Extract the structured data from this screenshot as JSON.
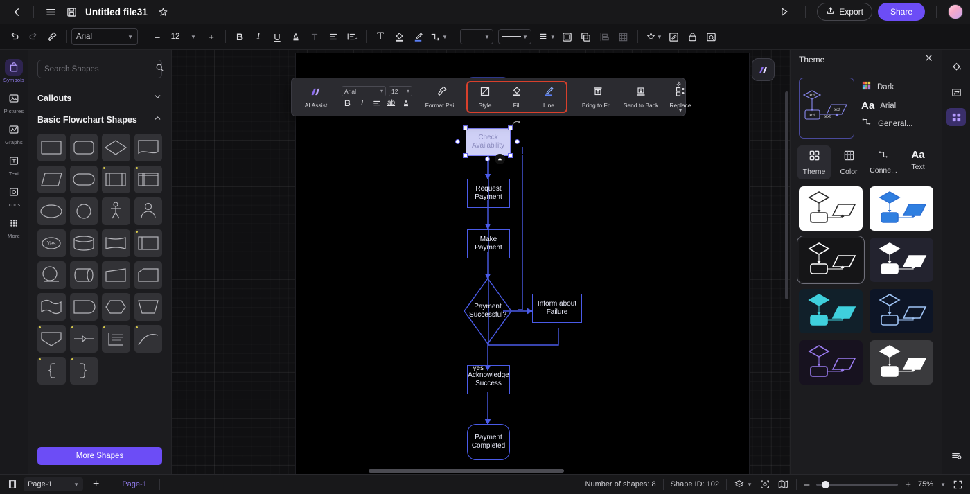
{
  "header": {
    "back_icon": "chevron-left-icon",
    "menu_icon": "hamburger-menu-icon",
    "save_icon": "floppy-save-icon",
    "title": "Untitled file31",
    "favorite_icon": "star-icon",
    "present_icon": "play-present-icon",
    "export_label": "Export",
    "export_icon": "upload-icon",
    "share_label": "Share",
    "avatar": "user-avatar"
  },
  "toolbar": {
    "undo_icon": "undo-icon",
    "redo_icon": "redo-icon",
    "format_painter_icon": "format-painter-icon",
    "font_family": "Arial",
    "font_size": "12",
    "decrease_label": "–",
    "increase_label": "+",
    "bold_label": "B",
    "italic_label": "I",
    "underline_label": "U",
    "font_color_label": "A",
    "strikethrough_label": "T",
    "align_icon": "align-left-icon",
    "line_spacing_icon": "line-spacing-icon",
    "text_box_label": "T",
    "fill_icon": "fill-bucket-icon",
    "line_brush_icon": "line-brush-icon",
    "connector_icon": "connector-icon",
    "line_style_icon": "line-style-icon",
    "line_weight_icon": "line-weight-icon",
    "list_icon": "list-icon",
    "frame_icon": "frame-icon",
    "duplicate_icon": "duplicate-icon",
    "distribute_icon": "distribute-icon",
    "table_icon": "table-icon",
    "magic_icon": "magic-wand-icon",
    "edit_icon": "edit-icon",
    "lock_icon": "lock-icon",
    "find_icon": "find-icon"
  },
  "rail": {
    "items": [
      {
        "label": "Symbols",
        "icon": "symbols-icon",
        "active": true
      },
      {
        "label": "Pictures",
        "icon": "pictures-icon",
        "active": false
      },
      {
        "label": "Graphs",
        "icon": "graphs-icon",
        "active": false
      },
      {
        "label": "Text",
        "icon": "text-icon",
        "active": false
      },
      {
        "label": "Icons",
        "icon": "icons-icon",
        "active": false
      },
      {
        "label": "More",
        "icon": "more-grid-icon",
        "active": false
      }
    ]
  },
  "shapes_panel": {
    "search_placeholder": "Search Shapes",
    "search_value": "",
    "search_icon": "search-icon",
    "sections": [
      {
        "title": "Callouts",
        "expanded": false,
        "chevron": "chevron-down-icon"
      },
      {
        "title": "Basic Flowchart Shapes",
        "expanded": true,
        "chevron": "chevron-up-icon"
      }
    ],
    "more_shapes_label": "More Shapes",
    "shape_cells": [
      {
        "shape": "rectangle",
        "badge": false
      },
      {
        "shape": "rounded-rectangle",
        "badge": false
      },
      {
        "shape": "diamond",
        "badge": false
      },
      {
        "shape": "document",
        "badge": false
      },
      {
        "shape": "parallelogram",
        "badge": false
      },
      {
        "shape": "stadium",
        "badge": false
      },
      {
        "shape": "predefined-process",
        "badge": true
      },
      {
        "shape": "internal-storage",
        "badge": true
      },
      {
        "shape": "ellipse",
        "badge": false
      },
      {
        "shape": "circle",
        "badge": false
      },
      {
        "shape": "manual-operation-person",
        "badge": false
      },
      {
        "shape": "actor",
        "badge": false
      },
      {
        "shape": "decision-yes",
        "badge": false
      },
      {
        "shape": "cylinder",
        "badge": false
      },
      {
        "shape": "tape",
        "badge": false
      },
      {
        "shape": "card",
        "badge": true
      },
      {
        "shape": "circle-connector",
        "badge": false
      },
      {
        "shape": "direct-access-storage",
        "badge": false
      },
      {
        "shape": "manual-input",
        "badge": false
      },
      {
        "shape": "trapezoid-top",
        "badge": false
      },
      {
        "shape": "wave-document",
        "badge": false
      },
      {
        "shape": "delay",
        "badge": false
      },
      {
        "shape": "preparation",
        "badge": false
      },
      {
        "shape": "manual-operation",
        "badge": false
      },
      {
        "shape": "extract",
        "badge": true
      },
      {
        "shape": "merge-connector",
        "badge": true
      },
      {
        "shape": "annotation",
        "badge": true
      },
      {
        "shape": "curve",
        "badge": true
      },
      {
        "shape": "left-brace",
        "badge": true
      },
      {
        "shape": "right-brace",
        "badge": true
      }
    ]
  },
  "context_toolbar": {
    "ai_assist_label": "AI Assist",
    "ai_assist_icon": "ai-assist-icon",
    "font_family": "Arial",
    "font_size": "12",
    "bold_label": "B",
    "italic_label": "I",
    "align_icon": "align-left-icon",
    "ab_label": "ab",
    "font_color_label": "A",
    "format_painter_label": "Format Pai...",
    "format_painter_icon": "format-painter-icon",
    "highlighted_group": [
      "Style",
      "Fill",
      "Line"
    ],
    "style_label": "Style",
    "style_icon": "style-icon",
    "fill_label": "Fill",
    "fill_icon": "fill-bucket-icon",
    "line_label": "Line",
    "line_icon": "line-brush-icon",
    "bring_front_label": "Bring to Fr...",
    "bring_front_icon": "bring-to-front-icon",
    "send_back_label": "Send to Back",
    "send_back_icon": "send-to-back-icon",
    "replace_label": "Replace",
    "replace_icon": "replace-icon",
    "pin_icon": "pin-icon",
    "highlight_color": "#d8402c"
  },
  "canvas": {
    "logo_badge_icon": "app-logo-icon",
    "accent_color": "#4a5be8",
    "selection_fill": "#cfd0f6",
    "nodes": [
      {
        "id": "top",
        "label": "",
        "shape": "rounded-rectangle",
        "selected": false
      },
      {
        "id": "check",
        "label": "Check Availability",
        "shape": "rectangle",
        "selected": true
      },
      {
        "id": "request",
        "label": "Request Payment",
        "shape": "rectangle",
        "selected": false
      },
      {
        "id": "make",
        "label": "Make Payment",
        "shape": "rectangle",
        "selected": false
      },
      {
        "id": "decision",
        "label": "Payment Successful?",
        "shape": "diamond",
        "selected": false
      },
      {
        "id": "failure",
        "label": "Inform about Failure",
        "shape": "rectangle",
        "selected": false
      },
      {
        "id": "ack",
        "label": "Acknowledge Success",
        "shape": "rectangle",
        "selected": false
      },
      {
        "id": "complete",
        "label": "Payment Completed",
        "shape": "rounded-rectangle",
        "selected": false
      }
    ],
    "edge_labels": [
      {
        "text": "yes"
      }
    ]
  },
  "theme_panel": {
    "title": "Theme",
    "close_icon": "close-icon",
    "preview_label": "theme-preview",
    "preview_text": "text",
    "meta": [
      {
        "icon": "color-grid-icon",
        "value": "Dark"
      },
      {
        "icon": "font-aa-icon",
        "value": "Arial"
      },
      {
        "icon": "connector-icon",
        "value": "General..."
      }
    ],
    "tabs": [
      {
        "label": "Theme",
        "icon": "theme-grid-icon",
        "active": true
      },
      {
        "label": "Color",
        "icon": "color-table-icon",
        "active": false
      },
      {
        "label": "Conne...",
        "icon": "connector-icon",
        "active": false
      },
      {
        "label": "Text",
        "icon": "font-aa-icon",
        "active": false
      }
    ],
    "swatches": [
      {
        "name": "light-plain",
        "bg": "#ffffff",
        "stroke": "#2b2b2b",
        "fill": "none",
        "active": false
      },
      {
        "name": "light-blue",
        "bg": "#ffffff",
        "stroke": "#2b6fd4",
        "fill": "#2f7fe0",
        "active": false
      },
      {
        "name": "dark-plain",
        "bg": "#151517",
        "stroke": "#ffffff",
        "fill": "none",
        "active": true
      },
      {
        "name": "dark-white",
        "bg": "#23232f",
        "stroke": "#ffffff",
        "fill": "#ffffff",
        "active": false
      },
      {
        "name": "dark-cyan",
        "bg": "#11202a",
        "stroke": "#3fd0dd",
        "fill": "#3fd0dd",
        "active": false
      },
      {
        "name": "navy-outline",
        "bg": "#0d1526",
        "stroke": "#9fc4f5",
        "fill": "none",
        "active": false
      },
      {
        "name": "purple-outline",
        "bg": "#17121f",
        "stroke": "#9a7bf0",
        "fill": "none",
        "active": false
      },
      {
        "name": "grey-white",
        "bg": "#3a3a3d",
        "stroke": "#ffffff",
        "fill": "#ffffff",
        "active": false
      }
    ]
  },
  "right_rail": {
    "items": [
      {
        "icon": "fill-bucket-icon",
        "active": false
      },
      {
        "icon": "replace-panel-icon",
        "active": false
      },
      {
        "icon": "theme-grid-icon",
        "active": true
      }
    ],
    "bottom_icon": "settings-list-icon"
  },
  "status_bar": {
    "page_view_icon": "page-view-icon",
    "page_select_value": "Page-1",
    "add_page_label": "+",
    "page_tab_label": "Page-1",
    "shapes_count_label": "Number of shapes: 8",
    "shape_id_label": "Shape ID: 102",
    "layers_icon": "layers-icon",
    "focus_icon": "focus-icon",
    "map_icon": "map-icon",
    "zoom_out_label": "–",
    "zoom_in_label": "+",
    "zoom_value": "75%",
    "fullscreen_icon": "fullscreen-icon"
  }
}
